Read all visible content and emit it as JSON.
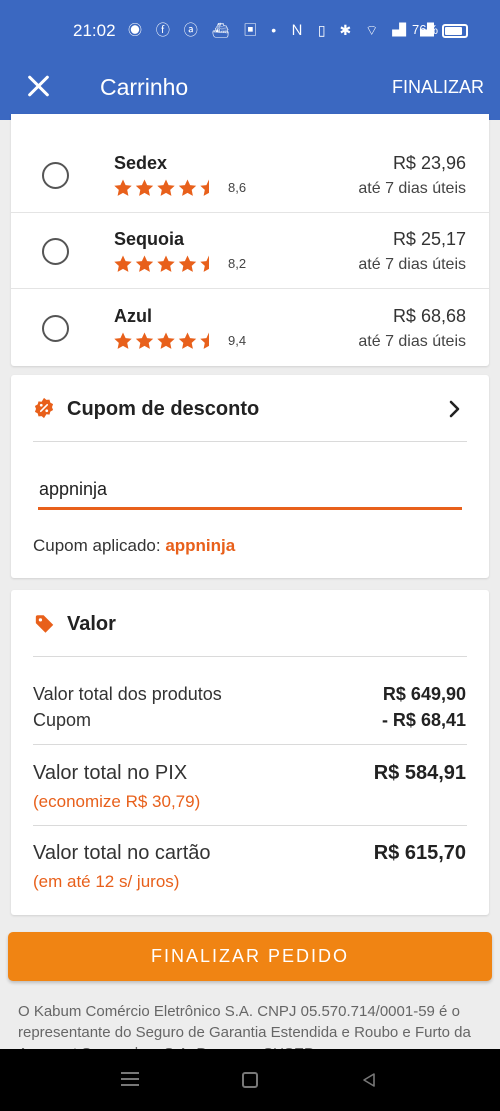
{
  "status_bar": {
    "time": "21:02",
    "icons": [
      "whatsapp-icon",
      "facebook-icon",
      "amazon-icon",
      "ship-icon",
      "app-icon",
      "dot-icon",
      "nfc-icon",
      "vibrate-icon",
      "bluetooth-icon",
      "wifi-icon",
      "signal-icon",
      "signal-icon"
    ],
    "battery": "76%"
  },
  "header": {
    "title": "Carrinho",
    "action": "FINALIZAR",
    "color": "#3b68c1"
  },
  "shipping": {
    "options": [
      {
        "name": "Sedex",
        "rating": "8,6",
        "stars": 4.5,
        "price": "R$ 23,96",
        "eta": "até 7 dias úteis"
      },
      {
        "name": "Sequoia",
        "rating": "8,2",
        "stars": 4.5,
        "price": "R$ 25,17",
        "eta": "até 7 dias úteis"
      },
      {
        "name": "Azul",
        "rating": "9,4",
        "stars": 4.5,
        "price": "R$ 68,68",
        "eta": "até 7 dias úteis"
      }
    ],
    "star_color": "#e8601b"
  },
  "coupon": {
    "title": "Cupom de desconto",
    "input_value": "appninja",
    "applied_label": "Cupom aplicado:",
    "applied_code": "appninja"
  },
  "value": {
    "title": "Valor",
    "products_label": "Valor total dos produtos",
    "products_value": "R$ 649,90",
    "coupon_label": "Cupom",
    "coupon_value": "- R$ 68,41",
    "pix_label": "Valor total no PIX",
    "pix_value": "R$ 584,91",
    "pix_note": "(economize R$ 30,79)",
    "card_label": "Valor total no cartão",
    "card_value": "R$ 615,70",
    "card_note": "(em até 12 s/ juros)"
  },
  "finalize_button": "FINALIZAR PEDIDO",
  "legal_text": "O Kabum Comércio Eletrônico S.A. CNPJ 05.570.714/0001-59 é o representante do Seguro de Garantia Estendida e Roubo e Furto da Assurant Seguradora S.A. Processo SUSEP:",
  "accent_color": "#e8601b",
  "button_color": "#f08413"
}
